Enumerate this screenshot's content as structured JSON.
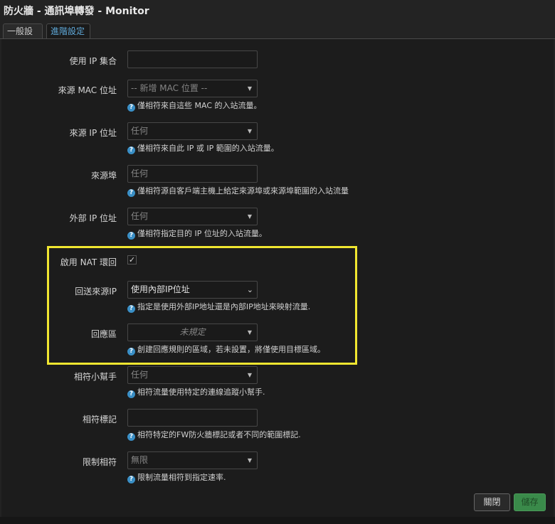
{
  "window": {
    "title": "防火牆 - 通訊埠轉發 - Monitor"
  },
  "tabs": [
    {
      "label": "一般設定",
      "active": false
    },
    {
      "label": "進階設定",
      "active": true
    }
  ],
  "form": {
    "ip_set": {
      "label": "使用 IP 集合",
      "value": ""
    },
    "src_mac": {
      "label": "來源 MAC 位址",
      "value": "-- 新增 MAC 位置 --",
      "help": "僅相符來自這些 MAC 的入站流量。"
    },
    "src_ip": {
      "label": "來源 IP 位址",
      "value": "任何",
      "help": "僅相符來自此 IP 或 IP 範圍的入站流量。"
    },
    "src_port": {
      "label": "來源埠",
      "placeholder": "任何",
      "help": "僅相符源自客戶端主機上給定來源埠或來源埠範圍的入站流量"
    },
    "ext_ip": {
      "label": "外部 IP 位址",
      "value": "任何",
      "help": "僅相符指定目的 IP 位址的入站流量。"
    },
    "nat_reflection": {
      "label": "啟用 NAT 環回",
      "checked": true
    },
    "reflection_src": {
      "label": "回送來源IP",
      "value": "使用內部IP位址",
      "help": "指定是使用外部IP地址還是內部IP地址來映射流量."
    },
    "reflection_zone": {
      "label": "回應區",
      "value": "未規定",
      "help": "創建回應規則的區域，若未設置，將僅使用目標區域。"
    },
    "helper": {
      "label": "相符小幫手",
      "value": "任何",
      "help": "相符流量使用特定的連線追蹤小幫手."
    },
    "mark": {
      "label": "相符標記",
      "value": "",
      "help": "相符特定的FW防火牆標記或者不同的範圍標記."
    },
    "limit": {
      "label": "限制相符",
      "value": "無限",
      "help": "限制流量相符到指定速率."
    }
  },
  "buttons": {
    "close": "關閉",
    "save": "儲存"
  },
  "colors": {
    "accent": "#5fa8d8",
    "highlight": "#f0e630",
    "save": "#3a8a4a"
  }
}
